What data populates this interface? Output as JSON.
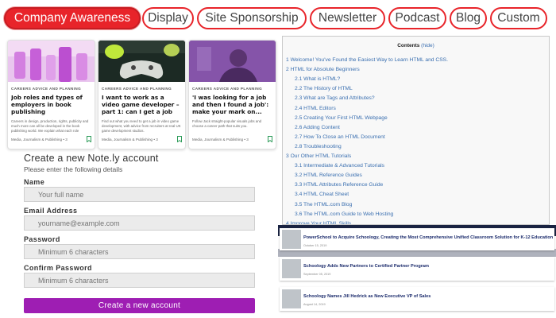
{
  "tabs": [
    {
      "label": "Company Awareness",
      "active": true
    },
    {
      "label": "Display",
      "active": false
    },
    {
      "label": "Site Sponsorship",
      "active": false
    },
    {
      "label": "Newsletter",
      "active": false
    },
    {
      "label": "Podcast",
      "active": false
    },
    {
      "label": "Blog",
      "active": false
    },
    {
      "label": "Custom",
      "active": false
    }
  ],
  "articles": [
    {
      "category": "CAREERS ADVICE AND PLANNING",
      "title": "Job roles and types of employers in book publishing",
      "description": "Careers in design, production, rights, publicity and much more can all be developed in the book publishing world. We explain what each role involves.",
      "footer": "Media, Journalism & Publishing • 3",
      "image": "pink-lab-photo"
    },
    {
      "category": "CAREERS ADVICE AND PLANNING",
      "title": "I want to work as a video game developer – part 1: can I get a job in...",
      "description": "Find out what you need to get a job in video game development, with advice from recruiters at real UK game development studios.",
      "footer": "Media, Journalism & Publishing • 3",
      "image": "game-controller-photo"
    },
    {
      "category": "CAREERS ADVICE AND PLANNING",
      "title": "'I was looking for a job and then I found a job': make your mark on...",
      "description": "Follow Jack straight-popular visuals jobs and choose a career path that suits you.",
      "footer": "Media, Journalism & Publishing • 3",
      "image": "purple-portrait-photo"
    }
  ],
  "signup": {
    "title": "Create a new Note.ly account",
    "subtitle": "Please enter the following details",
    "name_label": "Name",
    "name_placeholder": "Your full name",
    "email_label": "Email Address",
    "email_placeholder": "yourname@example.com",
    "password_label": "Password",
    "password_placeholder": "Minimum 6 characters",
    "confirm_label": "Confirm Password",
    "confirm_placeholder": "Minimum 6 characters",
    "submit_label": "Create a new account"
  },
  "toc": {
    "heading": "Contents",
    "hide_label": "(hide)",
    "items": [
      {
        "text": "1 Welcome! You've Found the Easiest Way to Learn HTML and CSS.",
        "level": 1
      },
      {
        "text": "2 HTML for Absolute Beginners",
        "level": 1
      },
      {
        "text": "2.1 What is HTML?",
        "level": 2
      },
      {
        "text": "2.2 The History of HTML",
        "level": 2
      },
      {
        "text": "2.3 What are Tags and Attributes?",
        "level": 2
      },
      {
        "text": "2.4 HTML Editors",
        "level": 2
      },
      {
        "text": "2.5 Creating Your First HTML Webpage",
        "level": 2
      },
      {
        "text": "2.6 Adding Content",
        "level": 2
      },
      {
        "text": "2.7 How To Close an HTML Document",
        "level": 2
      },
      {
        "text": "2.8 Troubleshooting",
        "level": 2
      },
      {
        "text": "3 Our Other HTML Tutorials",
        "level": 1
      },
      {
        "text": "3.1 Intermediate & Advanced Tutorials",
        "level": 2
      },
      {
        "text": "3.2 HTML Reference Guides",
        "level": 2
      },
      {
        "text": "3.3 HTML Attributes Reference Guide",
        "level": 2
      },
      {
        "text": "3.4 HTML Cheat Sheet",
        "level": 2
      },
      {
        "text": "3.5 The HTML.com Blog",
        "level": 2
      },
      {
        "text": "3.6 The HTML.com Guide to Web Hosting",
        "level": 2
      },
      {
        "text": "4 Improve Your HTML Skills",
        "level": 1
      }
    ]
  },
  "news": [
    {
      "title": "PowerSchool to Acquire Schoology, Creating the Most Comprehensive Unified Classroom Solution for K-12 Education",
      "date": "October 15, 2019"
    },
    {
      "title": "Schoology Adds New Partners to Certified Partner Program",
      "date": "September 05, 2019"
    },
    {
      "title": "Schoology Names Jill Hedrick as New Executive VP of Sales",
      "date": "August 14, 2019"
    }
  ],
  "colors": {
    "tab_accent": "#e8242a",
    "submit_button": "#9e1eb3",
    "toc_link": "#3a6fb0",
    "news_title": "#1a2a6b",
    "news_band": "#1a2342"
  }
}
